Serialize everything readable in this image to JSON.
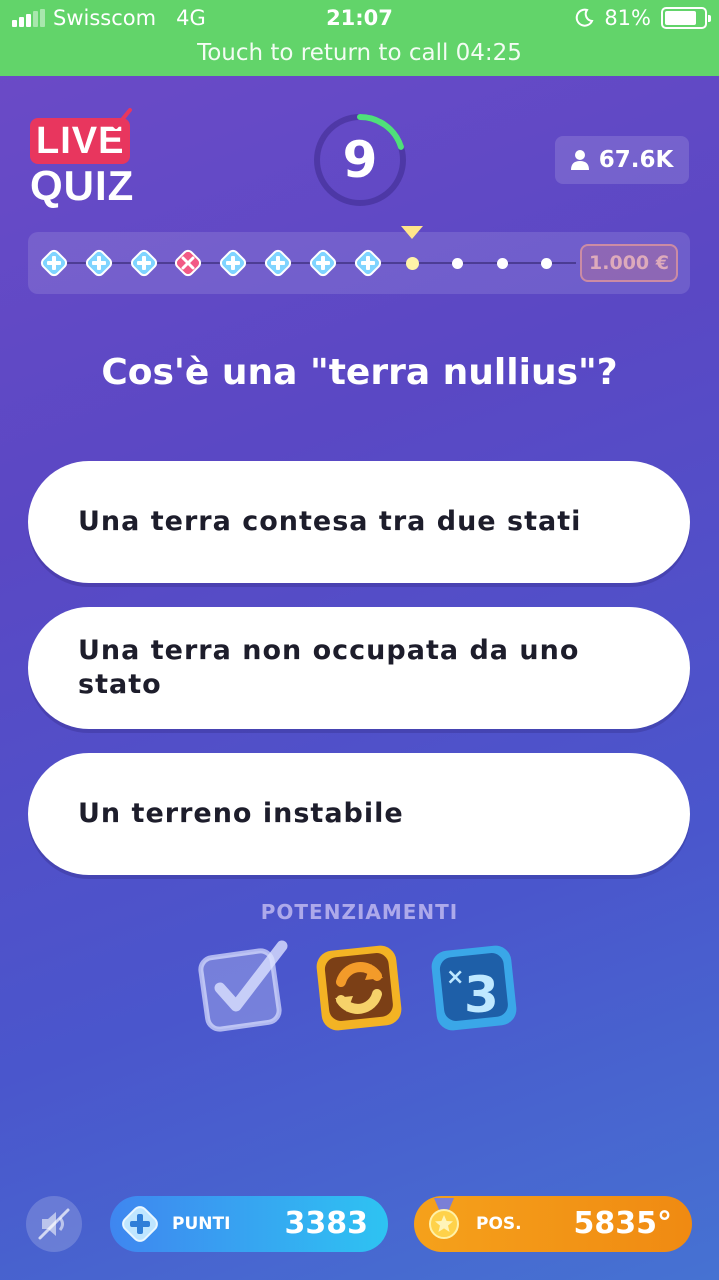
{
  "status_bar": {
    "carrier": "Swisscom",
    "network": "4G",
    "time": "21:07",
    "battery": "81%",
    "battery_level": 0.81,
    "call_banner": "Touch to return to call 04:25"
  },
  "header": {
    "logo_top": "LIVE",
    "logo_bottom": "QUIZ",
    "timer_value": "9",
    "timer_fraction_remaining": 0.2,
    "viewers": "67.6K"
  },
  "progress": {
    "states": [
      "correct",
      "correct",
      "correct",
      "wrong",
      "correct",
      "correct",
      "correct",
      "correct",
      "current",
      "upcoming",
      "upcoming",
      "upcoming"
    ],
    "prize": "1.000 €"
  },
  "question": "Cos'è una \"terra nullius\"?",
  "answers": [
    "Una terra contesa tra due stati",
    "Una terra non occupata da uno stato",
    "Un terreno instabile"
  ],
  "powerups": {
    "title": "POTENZIAMENTI",
    "items": [
      "check-icon",
      "refresh-icon",
      "times-three-icon"
    ]
  },
  "footer": {
    "points_label": "PUNTI",
    "points_value": "3383",
    "position_label": "POS.",
    "position_value": "5835°"
  },
  "colors": {
    "status_green": "#62d46a",
    "live_red": "#e8365e",
    "points_blue": "#3f86f0",
    "position_orange": "#f5a11b"
  }
}
